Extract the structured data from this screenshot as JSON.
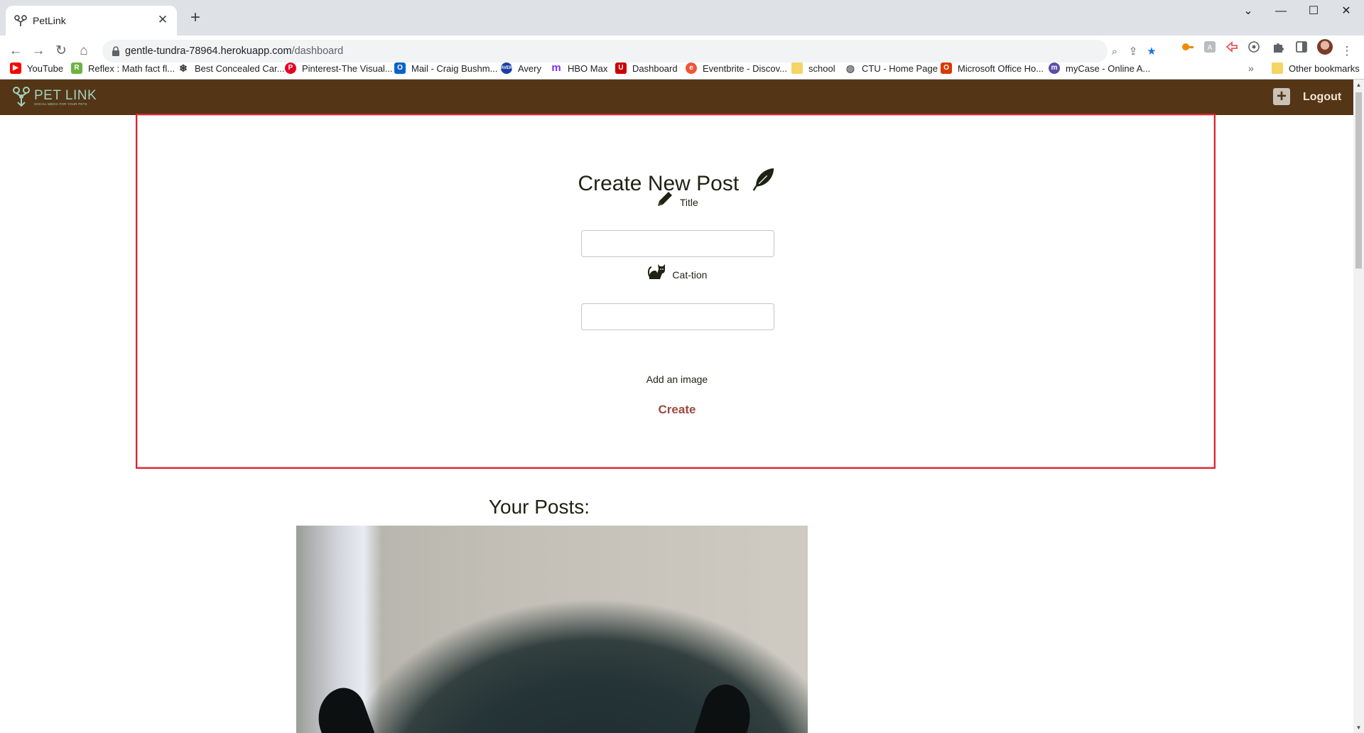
{
  "browser": {
    "tab_title": "PetLink",
    "url_host": "gentle-tundra-78964.herokuapp.com",
    "url_path": "/dashboard",
    "other_bookmarks_label": "Other bookmarks",
    "bookmarks": [
      {
        "label": "YouTube",
        "icon": "youtube-icon",
        "color": "#ff0000"
      },
      {
        "label": "Reflex : Math fact fl...",
        "icon": "reflex-icon",
        "color": "#6cb33f"
      },
      {
        "label": "Best Concealed Car...",
        "icon": "snowflake-icon",
        "color": "#333333"
      },
      {
        "label": "Pinterest-The Visual...",
        "icon": "pinterest-icon",
        "color": "#e60023"
      },
      {
        "label": "Mail - Craig Bushm...",
        "icon": "outlook-icon",
        "color": "#0a64c8"
      },
      {
        "label": "Avery",
        "icon": "avery-icon",
        "color": "#1a3fa8"
      },
      {
        "label": "HBO Max",
        "icon": "hbomax-icon",
        "color": "#7b2ff7"
      },
      {
        "label": "Dashboard",
        "icon": "dashboard-icon",
        "color": "#cc0000"
      },
      {
        "label": "Eventbrite - Discov...",
        "icon": "eventbrite-icon",
        "color": "#f05537"
      },
      {
        "label": "school",
        "icon": "folder-icon",
        "color": "#f6d365"
      },
      {
        "label": "CTU - Home Page",
        "icon": "globe-icon",
        "color": "#5f6368"
      },
      {
        "label": "Microsoft Office Ho...",
        "icon": "office-icon",
        "color": "#d83b01"
      },
      {
        "label": "myCase - Online A...",
        "icon": "mycase-icon",
        "color": "#5b4da8"
      }
    ]
  },
  "app": {
    "logo_text": "PET LINK",
    "logo_tagline": "SOCIAL MEDIA FOR YOUR PETS",
    "logout_label": "Logout",
    "brand_color": "#543515",
    "accent_color": "#9a4a3e",
    "border_color": "#d9242f"
  },
  "create_post": {
    "heading": "Create New Post",
    "title_label": "Title",
    "title_value": "",
    "caption_label": "Cat-tion",
    "caption_value": "",
    "add_image_label": "Add an image",
    "submit_label": "Create"
  },
  "posts": {
    "heading": "Your Posts:"
  }
}
